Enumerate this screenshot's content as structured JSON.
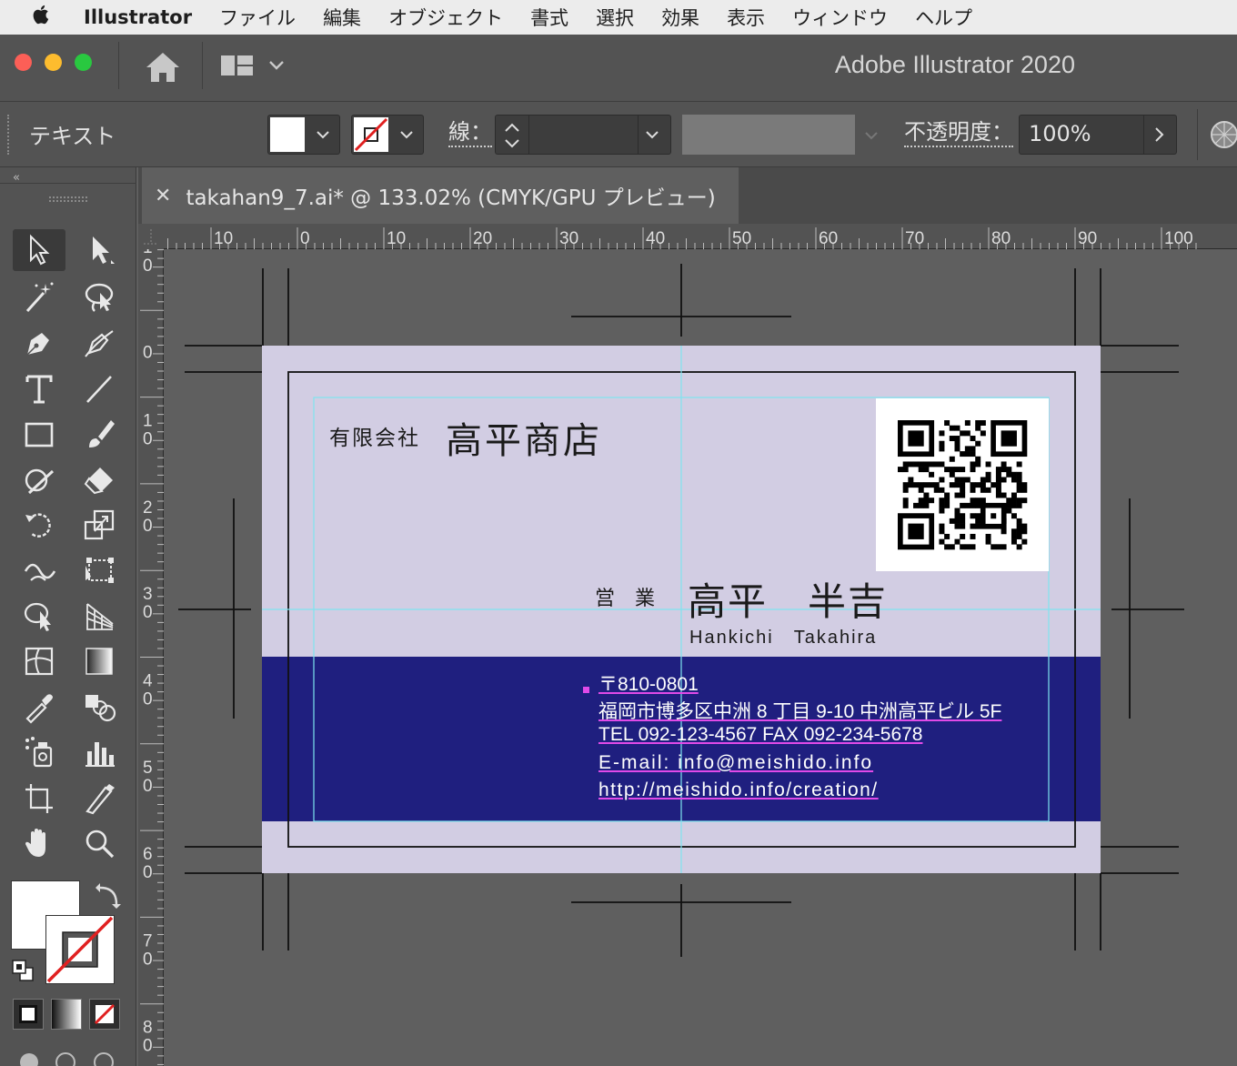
{
  "menubar": {
    "app_name": "Illustrator",
    "items": [
      "ファイル",
      "編集",
      "オブジェクト",
      "書式",
      "選択",
      "効果",
      "表示",
      "ウィンドウ",
      "ヘルプ"
    ]
  },
  "window": {
    "title": "Adobe Illustrator 2020"
  },
  "controlbar": {
    "selection_label": "テキスト",
    "stroke_label": "線：",
    "opacity_label": "不透明度：",
    "opacity_value": "100%"
  },
  "document_tab": {
    "title": "takahan9_7.ai* @ 133.02% (CMYK/GPU プレビュー)"
  },
  "rulers": {
    "horizontal": [
      "10",
      "0",
      "10",
      "20",
      "30",
      "40",
      "50",
      "60",
      "70",
      "80",
      "90",
      "100"
    ],
    "vertical": [
      "1 0",
      "0",
      "1 0",
      "2 0",
      "3 0",
      "4 0",
      "5 0",
      "6 0",
      "7 0",
      "8 0"
    ]
  },
  "card": {
    "company_prefix": "有限会社",
    "company_name": "高平商店",
    "department": "営　業",
    "person_name": "高平　半吉",
    "person_name_roman": "Hankichi　Takahira",
    "postal": "〒810-0801",
    "address": "福岡市博多区中洲 8 丁目 9-10  中洲高平ビル 5F",
    "tel_fax": "TEL 092-123-4567  FAX 092-234-5678",
    "email": "E-mail: info@meishido.info",
    "url": "http://meishido.info/creation/"
  },
  "colors": {
    "card_bg": "#d2cde3",
    "band": "#1f1f7f",
    "guide": "#7fe4f0",
    "selection": "#e04ae8",
    "ui_dark": "#535353",
    "canvas": "#5f5f5f"
  },
  "tools_panel": {
    "tools": [
      "selection-tool",
      "direct-selection-tool",
      "magic-wand-tool",
      "lasso-tool",
      "pen-tool",
      "curvature-tool",
      "type-tool",
      "line-segment-tool",
      "rectangle-tool",
      "paintbrush-tool",
      "shaper-tool",
      "eraser-tool",
      "rotate-tool",
      "scale-tool",
      "warp-tool",
      "free-transform-tool",
      "shape-builder-tool",
      "perspective-grid-tool",
      "mesh-tool",
      "gradient-tool",
      "eyedropper-tool",
      "blend-tool",
      "symbol-sprayer-tool",
      "column-graph-tool",
      "artboard-tool",
      "slice-tool",
      "hand-tool",
      "zoom-tool"
    ]
  }
}
